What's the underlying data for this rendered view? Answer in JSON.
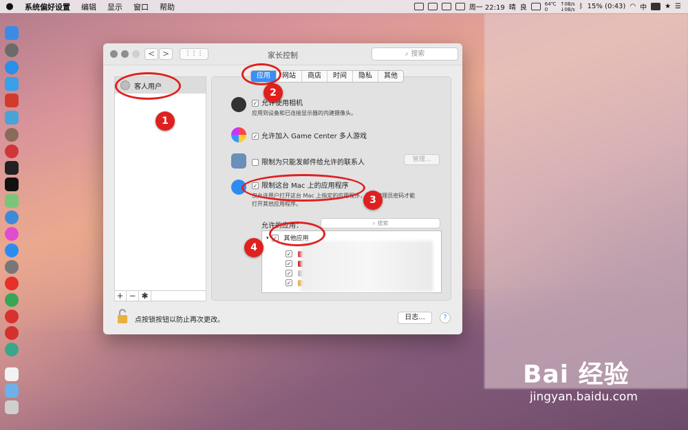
{
  "menubar": {
    "apple": "",
    "items": [
      "系统偏好设置",
      "编辑",
      "显示",
      "窗口",
      "帮助"
    ],
    "status": {
      "temp": "64℃",
      "temp_sub": "0",
      "net_up": "↑0B/s",
      "net_down": "↓0B/s",
      "datetime": "周一 22:19",
      "weather": "晴",
      "mood": "良",
      "battery": "15% (0:43)",
      "input": "中"
    }
  },
  "window": {
    "title": "家长控制",
    "search_placeholder": "搜索",
    "nav_back": "<",
    "nav_forward": ">",
    "grid": "⋮⋮⋮"
  },
  "users": [
    {
      "name": "客人用户"
    }
  ],
  "list_tools": {
    "add": "+",
    "remove": "−",
    "gear": "✱"
  },
  "tabs": [
    {
      "label": "应用",
      "active": true
    },
    {
      "label": "网站",
      "active": false
    },
    {
      "label": "商店",
      "active": false
    },
    {
      "label": "时间",
      "active": false
    },
    {
      "label": "隐私",
      "active": false
    },
    {
      "label": "其他",
      "active": false
    }
  ],
  "options": {
    "camera_label": "允许使用相机",
    "camera_sub": "应用到设备和已连接显示器的内建摄像头。",
    "gamecenter_label": "允许加入 Game Center 多人游戏",
    "mail_label": "限制为只能发邮件给允许的联系人",
    "manage_label": "管理...",
    "limit_apps_label": "限制这台 Mac 上的应用程序",
    "limit_apps_sub1": "仅允许用户打开这台 Mac 上指定的应用程序，需要管理员密码才能",
    "limit_apps_sub2": "打开其他应用程序。"
  },
  "allowed_apps": {
    "label": "允许的应用：",
    "search_placeholder": "搜索",
    "root_label": "其他应用"
  },
  "footer": {
    "lock_text": "点按锁按钮以防止再次更改。",
    "log_button": "日志...",
    "help": "?"
  },
  "annotations": [
    "1",
    "2",
    "3",
    "4"
  ],
  "watermark": {
    "main": "Bai 经验",
    "sub": "jingyan.baidu.com"
  },
  "colors": {
    "accent": "#3a8ef5",
    "annotation": "#e0201e"
  }
}
